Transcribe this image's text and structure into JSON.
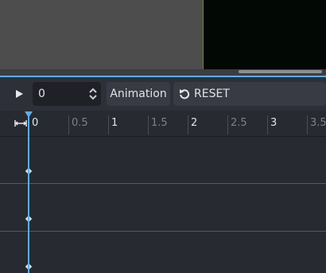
{
  "toolbar": {
    "frame_value": "0",
    "animation_label": "Animation",
    "reset_label": "RESET"
  },
  "timeline": {
    "ticks": [
      "0",
      "0.5",
      "1",
      "1.5",
      "2",
      "2.5",
      "3",
      "3.5"
    ]
  },
  "icons": {
    "play": "play-icon",
    "spinner": "spinner-arrows-icon",
    "reset": "reset-icon",
    "zoom": "horizontal-resize-icon"
  },
  "colors": {
    "accent": "#5aaee8",
    "viewport_border": "#6a8a2a"
  }
}
